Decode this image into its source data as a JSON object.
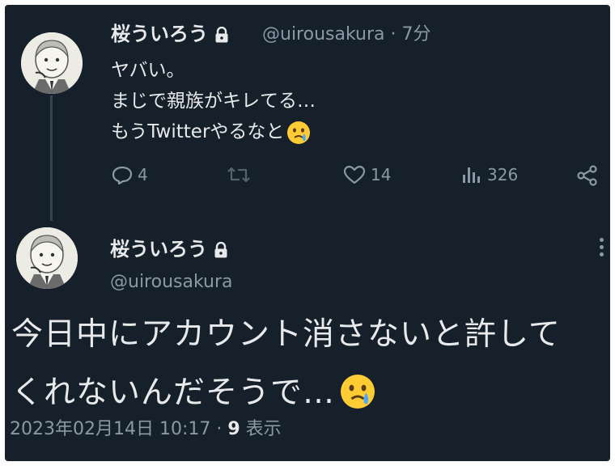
{
  "reply_tweet": {
    "display_name": "桜ういろう",
    "handle": "@uirousakura",
    "separator": " · ",
    "time": "7分",
    "lines": [
      "ヤバい。",
      "まじで親族がキレてる…",
      "もうTwitterやるなと"
    ],
    "actions": {
      "reply_count": "4",
      "retweet_count": "",
      "like_count": "14",
      "view_count": "326"
    }
  },
  "main_tweet": {
    "display_name": "桜ういろう",
    "handle": "@uirousakura",
    "lines": [
      "今日中にアカウント消さないと許して",
      "くれないんだそうで…"
    ],
    "timestamp": "2023年02月14日 10:17",
    "separator": " · ",
    "views": "9",
    "views_label": " 表示"
  },
  "icons": {
    "lock": "lock-icon",
    "emoji": "face-holding-back-tears-emoji",
    "reply": "reply-icon",
    "retweet": "retweet-icon",
    "like": "heart-icon",
    "views": "bar-chart-icon",
    "share": "share-icon",
    "more": "more-vertical-icon"
  },
  "colors": {
    "background": "#15202b",
    "primary_text": "#e7e9ea",
    "secondary_text": "#8b98a5"
  }
}
